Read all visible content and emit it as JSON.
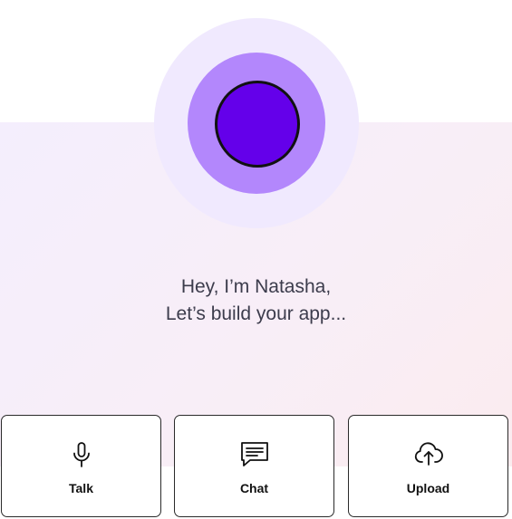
{
  "greeting": {
    "line1": "Hey, I’m Natasha,",
    "line2": "Let’s build your app..."
  },
  "actions": [
    {
      "label": "Talk",
      "icon": "microphone-icon"
    },
    {
      "label": "Chat",
      "icon": "chat-icon"
    },
    {
      "label": "Upload",
      "icon": "cloud-upload-icon"
    }
  ],
  "colors": {
    "orb_outer": "#f0e9fe",
    "orb_middle": "#b387fc",
    "orb_core": "#6400ea",
    "text": "#3c3c4c"
  }
}
